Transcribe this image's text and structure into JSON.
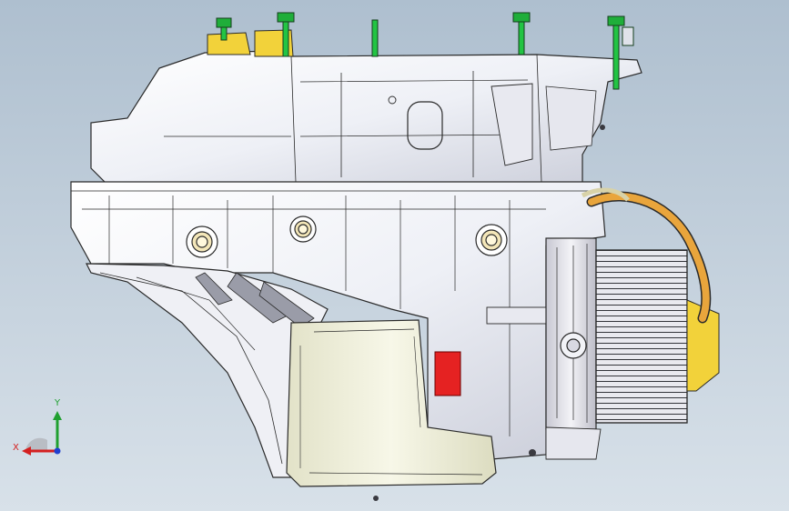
{
  "viewport": {
    "colors": {
      "background_top": "#aebfcf",
      "background_bottom": "#d8e1e9",
      "housing_fill": "#f2f3f7",
      "housing_edge": "#2a2a2a",
      "pan_fill": "#eeeed8",
      "bolt_green": "#1fae3a",
      "bracket_yellow": "#f2d23a",
      "marker_red": "#e52222",
      "cable_orange": "#e9a53c"
    },
    "triad": {
      "x_label": "X",
      "y_label": "Y",
      "x_color": "#d42020",
      "y_color": "#20a030",
      "z_color": "#2040d0"
    }
  }
}
